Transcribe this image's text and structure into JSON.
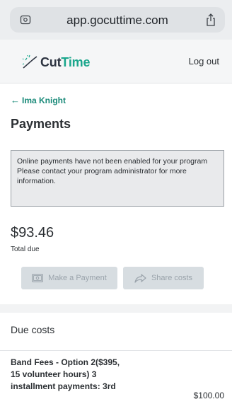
{
  "browser": {
    "url": "app.gocuttime.com",
    "site_icon": "site-settings-icon",
    "share_icon": "share-icon"
  },
  "header": {
    "logo_part1": "Cut",
    "logo_part2": "Time",
    "logout_label": "Log out"
  },
  "back": {
    "arrow": "←",
    "label": "Ima Knight"
  },
  "page": {
    "title": "Payments"
  },
  "notice": {
    "line1": "Online payments have not been enabled for your program",
    "line2": "Please contact your program administrator for more information."
  },
  "total": {
    "amount": "$93.46",
    "label": "Total due"
  },
  "actions": {
    "pay_label": "Make a Payment",
    "share_label": "Share costs"
  },
  "due_costs": {
    "title": "Due costs",
    "items": [
      {
        "description": "Band Fees - Option 2($395, 15 volunteer hours) 3 installment payments: 3rd",
        "amount": "$100.00"
      }
    ]
  },
  "colors": {
    "brand_teal": "#1aa68c",
    "link_teal": "#1a8a79",
    "disabled_button": "#d7dde1"
  }
}
